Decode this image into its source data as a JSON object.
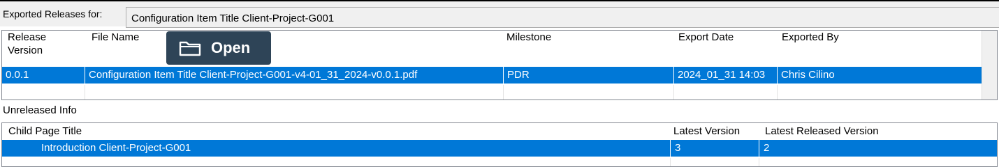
{
  "header": {
    "exported_label": "Exported Releases for:",
    "item_title": "Configuration Item Title Client-Project-G001"
  },
  "releases": {
    "columns": [
      "Release\nVersion",
      "File Name",
      "Milestone",
      "Export Date",
      "Exported By"
    ],
    "rows": [
      {
        "version": "0.0.1",
        "file_name": "Configuration Item Title Client-Project-G001-v4-01_31_2024-v0.0.1.pdf",
        "milestone": "PDR",
        "export_date": "2024_01_31 14:03",
        "exported_by": "Chris Cilino"
      }
    ]
  },
  "open_button": {
    "label": "Open",
    "icon": "folder-icon"
  },
  "unreleased": {
    "label": "Unreleased Info",
    "columns": [
      "Child Page Title",
      "Latest Version",
      "Latest Released Version"
    ],
    "rows": [
      {
        "title": "Introduction Client-Project-G001",
        "latest_version": "3",
        "latest_released_version": "2"
      }
    ]
  },
  "colors": {
    "selection": "#0078d7",
    "overlay_button": "#2e4457",
    "bar_background": "#f0f0f0"
  }
}
